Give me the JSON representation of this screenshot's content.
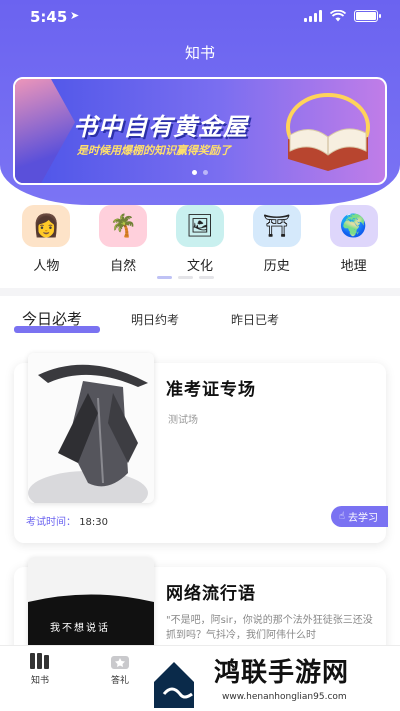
{
  "status": {
    "time": "5:45"
  },
  "header": {
    "title": "知书"
  },
  "banner": {
    "title": "书中自有黄金屋",
    "subtitle": "是时候用爆棚的知识赢得奖励了"
  },
  "categories": [
    {
      "label": "人物",
      "icon": "person-icon",
      "color": "#fde3c8"
    },
    {
      "label": "自然",
      "icon": "nature-icon",
      "color": "#ffd0dc"
    },
    {
      "label": "文化",
      "icon": "culture-icon",
      "color": "#c9f0ef"
    },
    {
      "label": "历史",
      "icon": "history-icon",
      "color": "#d5e9fb"
    },
    {
      "label": "地理",
      "icon": "geography-icon",
      "color": "#ded6fb"
    }
  ],
  "tabs": {
    "today": "今日必考",
    "tomorrow": "明日约考",
    "yesterday": "昨日已考"
  },
  "cards": [
    {
      "title": "准考证专场",
      "subtitle": "测试场",
      "time_label": "考试时间：",
      "time": "18:30",
      "button": "去学习"
    },
    {
      "title": "网络流行语",
      "desc": "\"不是吧，阿sir，你说的那个法外狂徒张三还没抓到吗？气抖冷，我们阿伟什么时",
      "img_text": "我不想说话"
    }
  ],
  "tabbar": {
    "item1": "知书",
    "item2": "答礼"
  },
  "watermark": {
    "name": "鸿联手游网",
    "url": "www.henanhonglian95.com"
  },
  "colors": {
    "accent": "#6b63f0"
  }
}
